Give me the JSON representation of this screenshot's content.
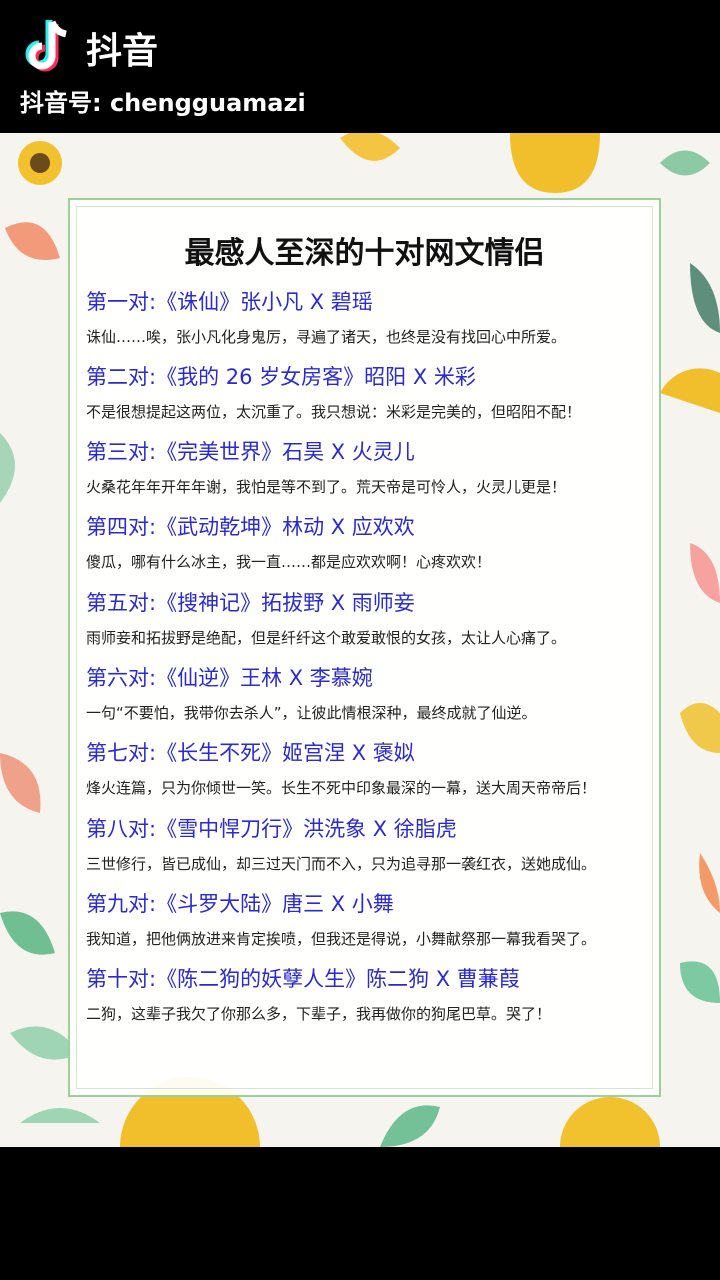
{
  "header": {
    "app_name": "抖音",
    "handle": "抖音号: chengguamazi"
  },
  "article": {
    "title": "最感人至深的十对网文情侣",
    "pairs": [
      {
        "head": "第一对:《诛仙》张小凡 X 碧瑶",
        "desc": "诛仙……唉，张小凡化身鬼厉，寻遍了诸天，也终是没有找回心中所爱。"
      },
      {
        "head": "第二对:《我的 26 岁女房客》昭阳 X 米彩",
        "desc": "不是很想提起这两位，太沉重了。我只想说：米彩是完美的，但昭阳不配！"
      },
      {
        "head": "第三对:《完美世界》石昊 X 火灵儿",
        "desc": "火桑花年年开年年谢，我怕是等不到了。荒天帝是可怜人，火灵儿更是！"
      },
      {
        "head": "第四对:《武动乾坤》林动 X 应欢欢",
        "desc": "傻瓜，哪有什么冰主，我一直……都是应欢欢啊！心疼欢欢！"
      },
      {
        "head": "第五对:《搜神记》拓拔野 X 雨师妾",
        "desc": "雨师妾和拓拔野是绝配，但是纤纤这个敢爱敢恨的女孩，太让人心痛了。"
      },
      {
        "head": "第六对:《仙逆》王林 X 李慕婉",
        "desc": "一句“不要怕，我带你去杀人”，让彼此情根深种，最终成就了仙逆。"
      },
      {
        "head": "第七对:《长生不死》姬宫涅 X 褒姒",
        "desc": "烽火连篇，只为你倾世一笑。长生不死中印象最深的一幕，送大周天帝帝后！"
      },
      {
        "head": "第八对:《雪中悍刀行》洪洗象 X 徐脂虎",
        "desc": "三世修行，皆已成仙，却三过天门而不入，只为追寻那一袭红衣，送她成仙。"
      },
      {
        "head": "第九对:《斗罗大陆》唐三 X 小舞",
        "desc": "我知道，把他俩放进来肯定挨喷，但我还是得说，小舞献祭那一幕我看哭了。"
      },
      {
        "head": "第十对:《陈二狗的妖孽人生》陈二狗 X 曹蒹葭",
        "desc": "二狗，这辈子我欠了你那么多，下辈子，我再做你的狗尾巴草。哭了！"
      }
    ]
  },
  "colors": {
    "pair_head": "#2a2ad0",
    "frame_green": "#9ccf9a",
    "background": "#f6f4ee"
  }
}
